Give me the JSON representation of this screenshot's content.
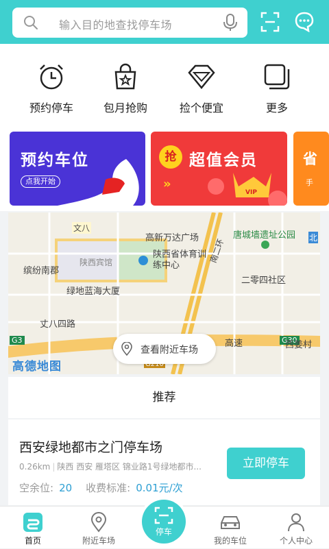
{
  "header": {
    "search_placeholder": "输入目的地查找停车场"
  },
  "quick_menu": [
    {
      "label": "预约停车"
    },
    {
      "label": "包月抢购"
    },
    {
      "label": "捡个便宜"
    },
    {
      "label": "更多"
    }
  ],
  "banners": {
    "reserve": {
      "title": "预约车位",
      "pill": "点我开始"
    },
    "member": {
      "badge": "抢",
      "title": "超值会员",
      "arrows": "»",
      "vip": "VIP"
    },
    "save": {
      "title": "省",
      "sub": "手"
    }
  },
  "map": {
    "labels": [
      "文八",
      "高新万达广场",
      "唐城墙遗址公园",
      "陕西省体育训练中心",
      "缤纷南郡",
      "陕西宾馆",
      "绿地蓝海大厦",
      "二零四社区",
      "丈八四路",
      "高速",
      "G30",
      "西姜村",
      "南二环",
      "北",
      "G3",
      "G210"
    ],
    "nearby_button": "查看附近车场",
    "logo": "高德地图"
  },
  "recommend": {
    "heading": "推荐",
    "card": {
      "name": "西安绿地都市之门停车场",
      "distance": "0.26km",
      "address": "陕西 西安 雁塔区 锦业路1号绿地都市...",
      "free_label": "空余位:",
      "free_value": "20",
      "fee_label": "收费标准:",
      "fee_value": "0.01元/次",
      "button": "立即停车"
    }
  },
  "tabbar": [
    {
      "label": "首页"
    },
    {
      "label": "附近车场"
    },
    {
      "label": "停车"
    },
    {
      "label": "我的车位"
    },
    {
      "label": "个人中心"
    }
  ],
  "colors": {
    "accent": "#3fd0cf",
    "link": "#2d9fd3",
    "banner_purple": "#4a33d6",
    "banner_red": "#f03a3a",
    "banner_orange": "#ff8a1e"
  }
}
